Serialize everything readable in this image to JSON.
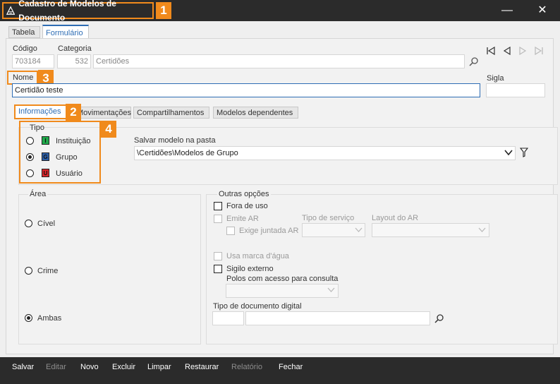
{
  "window": {
    "title": "Cadastro de Modelos de Documento",
    "minimize": "—",
    "close": "✕"
  },
  "callouts": [
    "1",
    "2",
    "3",
    "4"
  ],
  "tabs": [
    "Tabela",
    "Formulário"
  ],
  "header": {
    "codigo_label": "Código",
    "codigo_value": "703184",
    "categoria_label": "Categoria",
    "categoria_code": "532",
    "categoria_name": "Certidões",
    "nome_label": "Nome",
    "nome_value": "Certidão teste",
    "sigla_label": "Sigla",
    "sigla_value": ""
  },
  "subtabs": [
    "Informações",
    "Movimentações",
    "Compartilhamentos",
    "Modelos dependentes"
  ],
  "tipo": {
    "label": "Tipo",
    "options": [
      {
        "label": "Instituição",
        "letter": "I",
        "color": "#1fa84a",
        "selected": false
      },
      {
        "label": "Grupo",
        "letter": "G",
        "color": "#2b5fa8",
        "selected": true
      },
      {
        "label": "Usuário",
        "letter": "U",
        "color": "#d9262a",
        "selected": false
      }
    ]
  },
  "pasta": {
    "label": "Salvar modelo na pasta",
    "value": "\\Certidões\\Modelos de Grupo"
  },
  "area": {
    "label": "Área",
    "options": [
      {
        "label": "Cível",
        "selected": false
      },
      {
        "label": "Crime",
        "selected": false
      },
      {
        "label": "Ambas",
        "selected": true
      }
    ]
  },
  "outras": {
    "label": "Outras opções",
    "fora_de_uso": "Fora de uso",
    "emite_ar": "Emite AR",
    "exige_juntada_ar": "Exige juntada AR",
    "tipo_servico": "Tipo de serviço",
    "layout_ar": "Layout do AR",
    "usa_marca": "Usa marca d'água",
    "sigilo_externo": "Sigilo externo",
    "polos_label": "Polos com acesso para consulta",
    "tipo_doc_label": "Tipo de documento digital"
  },
  "buttons": {
    "salvar": "Salvar",
    "editar": "Editar",
    "novo": "Novo",
    "excluir": "Excluir",
    "limpar": "Limpar",
    "restaurar": "Restaurar",
    "relatorio": "Relatório",
    "fechar": "Fechar"
  },
  "colors": {
    "accent": "#f08a1c",
    "titlebar": "#2b2b2b",
    "active_tab_text": "#2e6db4"
  }
}
